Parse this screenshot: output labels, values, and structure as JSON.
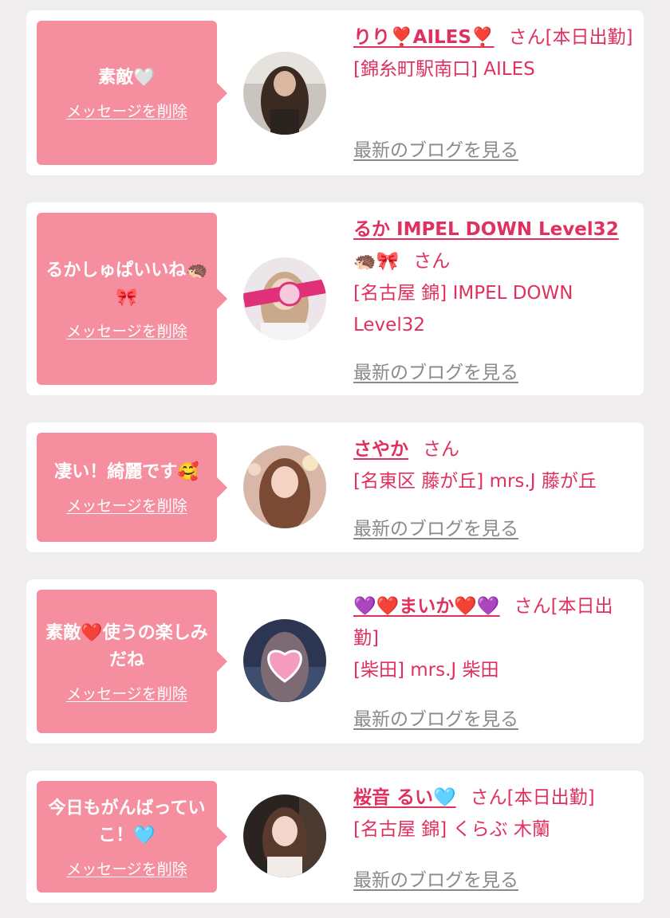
{
  "cards": [
    {
      "message": "素敵🤍",
      "delete_label": "メッセージを削除",
      "name": "りり❣️AILES❣️",
      "honorific": "さん[本日出勤]",
      "shop": "[錦糸町駅南口] AILES",
      "blog_label": "最新のブログを見る",
      "avatar": "avatar-dark-hair-woman"
    },
    {
      "message": "るかしゅぱいいね🦔🎀",
      "delete_label": "メッセージを削除",
      "name": "るか IMPEL DOWN Level32",
      "name_suffix": "🦔🎀",
      "honorific": "さん",
      "shop": "[名古屋 錦] IMPEL DOWN Level32",
      "blog_label": "最新のブログを見る",
      "avatar": "avatar-blonde-with-sticker"
    },
    {
      "message": "凄い！綺麗です🥰",
      "delete_label": "メッセージを削除",
      "name": "さやか",
      "honorific": "さん",
      "shop": "[名東区 藤が丘] mrs.J 藤が丘",
      "blog_label": "最新のブログを見る",
      "avatar": "avatar-long-brown-hair"
    },
    {
      "message": "素敵❤️使うの楽しみだね",
      "delete_label": "メッセージを削除",
      "name": "💜❤️まいか❤️💜",
      "honorific": "さん[本日出勤]",
      "shop": "[柴田] mrs.J 柴田",
      "blog_label": "最新のブログを見る",
      "avatar": "avatar-heart-sticker"
    },
    {
      "message": "今日もがんばっていこ！🩵",
      "delete_label": "メッセージを削除",
      "name": "桜音 るい🩵",
      "honorific": "さん[本日出勤]",
      "shop": "[名古屋 錦] くらぶ 木蘭",
      "blog_label": "最新のブログを見る",
      "avatar": "avatar-woman-night"
    }
  ],
  "colors": {
    "background": "#efeded",
    "card": "#ffffff",
    "bubble": "#f58fa0",
    "name": "#e0305e",
    "link_gray": "#8a8a8a"
  }
}
